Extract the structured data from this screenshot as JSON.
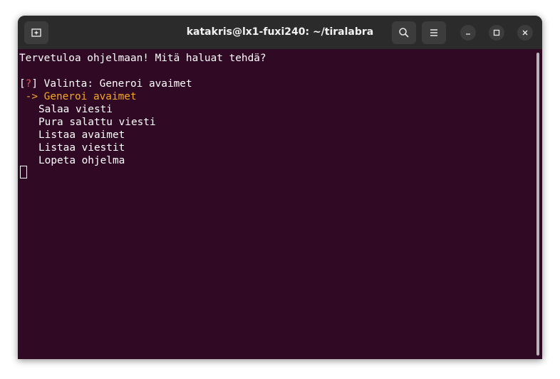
{
  "window": {
    "title": "katakris@lx1-fuxi240: ~/tiralabra"
  },
  "titlebar": {
    "new_tab_icon": "new-tab-icon",
    "search_icon": "search-icon",
    "menu_icon": "hamburger-menu-icon",
    "minimize_icon": "minimize-icon",
    "maximize_icon": "maximize-icon",
    "close_icon": "close-icon"
  },
  "terminal": {
    "welcome": "Tervetuloa ohjelmaan! Mitä haluat tehdä?",
    "prompt_open_bracket": "[",
    "prompt_mark": "?",
    "prompt_close_bracket": "]",
    "prompt_text": " Valinta: Generoi avaimet",
    "selected_prefix": " -> ",
    "options": [
      "Generoi avaimet",
      "Salaa viesti",
      "Pura salattu viesti",
      "Listaa avaimet",
      "Listaa viestit",
      "Lopeta ohjelma"
    ],
    "selected_color": "#f5a623",
    "background_color": "#300a24"
  }
}
